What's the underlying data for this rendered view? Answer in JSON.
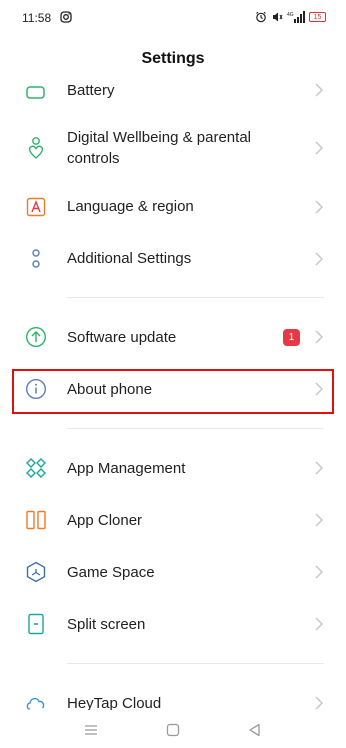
{
  "status_bar": {
    "time": "11:58",
    "battery": "15"
  },
  "header": {
    "title": "Settings"
  },
  "items": [
    {
      "label": "Battery",
      "icon": "battery-icon"
    },
    {
      "label": "Digital Wellbeing & parental controls",
      "icon": "wellbeing-icon"
    },
    {
      "label": "Language & region",
      "icon": "language-icon"
    },
    {
      "label": "Additional Settings",
      "icon": "additional-settings-icon"
    },
    {
      "label": "Software update",
      "icon": "software-update-icon",
      "badge": "1"
    },
    {
      "label": "About phone",
      "icon": "info-icon"
    },
    {
      "label": "App Management",
      "icon": "app-management-icon"
    },
    {
      "label": "App Cloner",
      "icon": "app-cloner-icon"
    },
    {
      "label": "Game Space",
      "icon": "game-space-icon"
    },
    {
      "label": "Split screen",
      "icon": "split-screen-icon"
    },
    {
      "label": "HeyTap Cloud",
      "icon": "cloud-icon"
    }
  ],
  "colors": {
    "accent_green": "#2fb36a",
    "badge_red": "#e53945",
    "highlight_red": "#e01010",
    "language_orange": "#f07a2a",
    "info_blue": "#5b7fb8"
  }
}
